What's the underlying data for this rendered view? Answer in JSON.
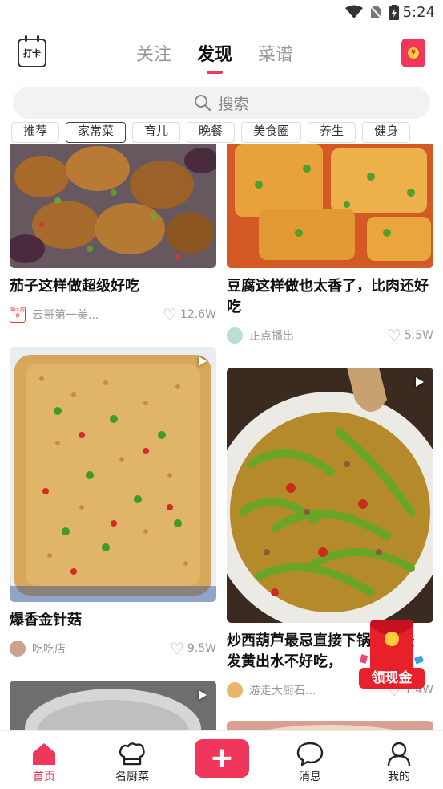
{
  "status": {
    "time": "5:24"
  },
  "header": {
    "checkin_label": "打卡",
    "tabs": [
      {
        "label": "关注"
      },
      {
        "label": "发现"
      },
      {
        "label": "菜谱"
      }
    ],
    "active_tab": "发现",
    "red_packet_symbol": "¥"
  },
  "search": {
    "placeholder": "搜索"
  },
  "categories": [
    {
      "label": "推荐"
    },
    {
      "label": "家常菜"
    },
    {
      "label": "育儿"
    },
    {
      "label": "晚餐"
    },
    {
      "label": "美食圈"
    },
    {
      "label": "养生"
    },
    {
      "label": "健身"
    }
  ],
  "feed": {
    "left": [
      {
        "title": "茄子这样做超级好吃",
        "author": "云哥第一美...",
        "likes": "12.6W",
        "video": false,
        "avatar_text": "萌①美食"
      },
      {
        "title": "爆香金针菇",
        "author": "吃吃店",
        "likes": "9.5W",
        "video": true
      },
      {
        "title": "",
        "author": "",
        "likes": "",
        "video": true
      }
    ],
    "right": [
      {
        "title": "豆腐这样做也太香了，比肉还好吃",
        "author": "正点播出",
        "likes": "5.5W",
        "video": false
      },
      {
        "title": "炒西葫芦最忌直接下锅，难怪发黄出水不好吃，",
        "author": "游走大厨石...",
        "likes": "1.4W",
        "video": true
      },
      {
        "title": "",
        "author": "",
        "likes": "",
        "video": false
      }
    ]
  },
  "float_red_packet": {
    "label": "领现金"
  },
  "bottom_nav": [
    {
      "label": "首页",
      "icon": "home-icon",
      "active": true
    },
    {
      "label": "名厨菜",
      "icon": "chef-hat-icon",
      "active": false
    },
    {
      "label": "",
      "icon": "plus-icon",
      "active": false
    },
    {
      "label": "消息",
      "icon": "message-icon",
      "active": false
    },
    {
      "label": "我的",
      "icon": "profile-icon",
      "active": false
    }
  ],
  "colors": {
    "accent": "#f0365a",
    "gold": "#ffce3a"
  }
}
